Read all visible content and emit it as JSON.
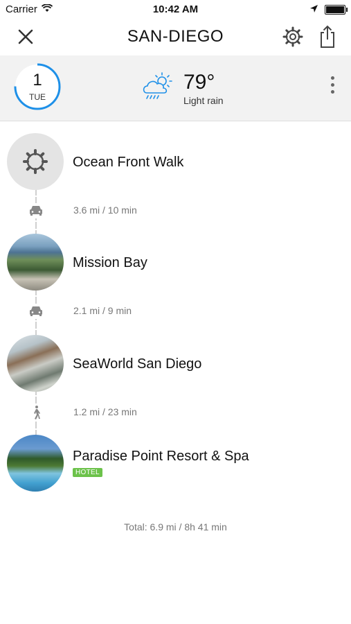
{
  "status_bar": {
    "carrier": "Carrier",
    "time": "10:42 AM"
  },
  "header": {
    "title": "SAN-DIEGO"
  },
  "weather": {
    "day_number": "1",
    "day_name": "TUE",
    "temperature": "79°",
    "condition": "Light rain",
    "icon": "cloud-rain-sun-icon"
  },
  "stops": [
    {
      "name": "Ocean Front Walk",
      "image": "placeholder-gear"
    },
    {
      "name": "Mission Bay",
      "image": "photo-bay"
    },
    {
      "name": "SeaWorld San Diego",
      "image": "photo-waterpark"
    },
    {
      "name": "Paradise Point Resort & Spa",
      "image": "photo-pool",
      "badge": "HOTEL"
    }
  ],
  "legs": [
    {
      "mode": "car",
      "distance": "3.6 mi / 10 min"
    },
    {
      "mode": "car",
      "distance": "2.1 mi / 9 min"
    },
    {
      "mode": "walk",
      "distance": "1.2 mi / 23 min"
    }
  ],
  "total": "Total: 6.9 mi / 8h 41 min",
  "colors": {
    "accent": "#1e90e8",
    "hotel_badge": "#6cc24a",
    "weather_bg": "#f2f2f2"
  }
}
